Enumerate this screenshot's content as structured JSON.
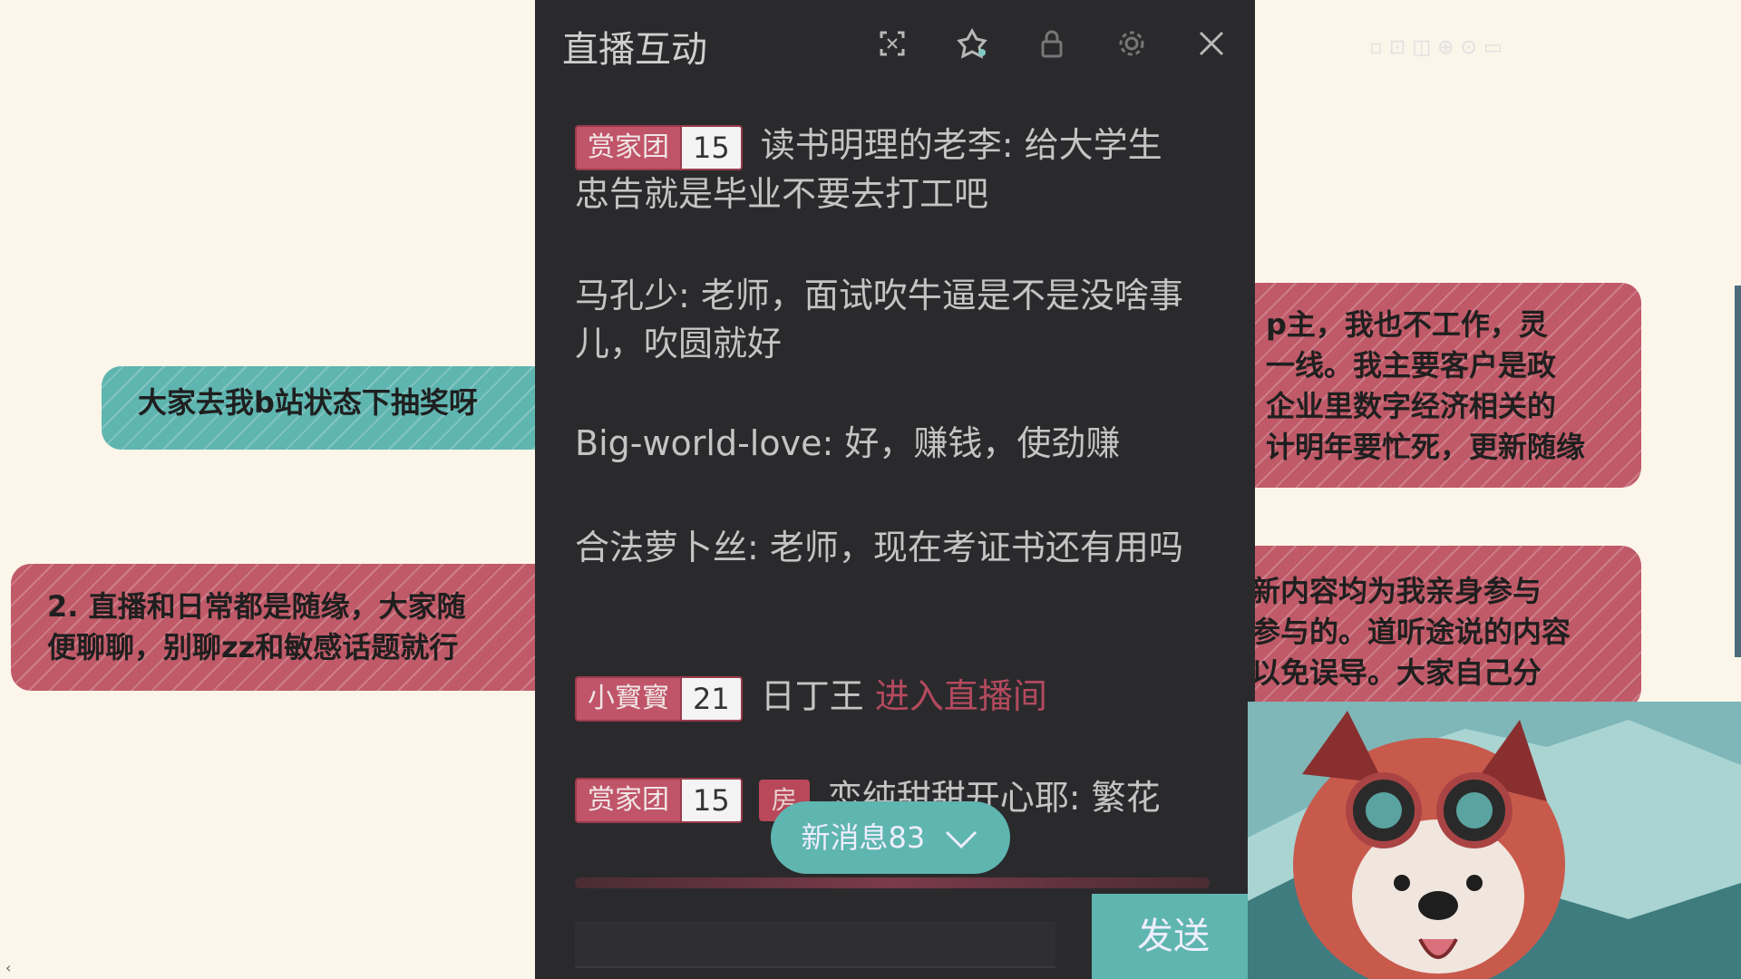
{
  "notes": {
    "left_teal": [
      "大家去我b站状态下抽奖呀"
    ],
    "left_red": [
      "2. 直播和日常都是随缘，大家随",
      "便聊聊，别聊zz和敏感话题就行"
    ],
    "right_top": [
      "p主，我也不工作，灵",
      "一线。我主要客户是政",
      "企业里数字经济相关的",
      "计明年要忙死，更新随缘"
    ],
    "right_mid": [
      "新内容均为我亲身参与",
      "参与的。道听途说的内容",
      "以免误导。大家自己分"
    ]
  },
  "panel": {
    "title": "直播互动",
    "icons": [
      "popout-icon",
      "badge-icon",
      "lock-icon",
      "settings-icon",
      "close-icon"
    ]
  },
  "messages": [
    {
      "badge_name": "赏家团",
      "badge_level": "15",
      "user": "读书明理的老李",
      "text": "给大学生忠告就是毕业不要去打工吧"
    },
    {
      "user": "马孔少",
      "text": "老师，面试吹牛逼是不是没啥事儿，吹圆就好"
    },
    {
      "user": "Big-world-love",
      "text": "好，赚钱，使劲赚"
    },
    {
      "user": "合法萝卜丝",
      "text": "老师，现在考证书还有用吗"
    },
    {
      "badge_name": "小寳寳",
      "badge_level": "21",
      "user": "日丁王",
      "text": "进入直播间"
    },
    {
      "badge_name": "赏家团",
      "badge_level": "15",
      "tag": "房",
      "user": "恋纯甜甜开心耶",
      "text": "繁花"
    }
  ],
  "new_messages": {
    "label": "新消息83"
  },
  "send_button": {
    "label": "发送"
  },
  "colors": {
    "teal": "#5fb5b0",
    "red": "#c05a68",
    "panel_bg": "#2a2a2c",
    "page_bg": "#fbf5ea"
  }
}
